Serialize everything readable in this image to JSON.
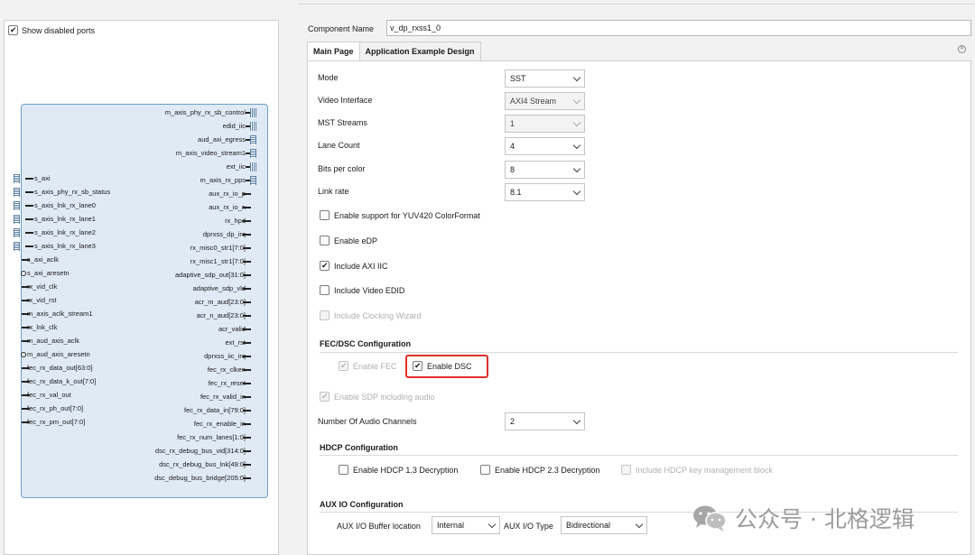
{
  "left": {
    "show_disabled_label": "Show disabled ports",
    "right_ports": [
      "m_axis_phy_rx_sb_control",
      "edid_iic",
      "aud_axi_egress",
      "m_axis_video_stream1",
      "ext_iic",
      "m_axis_rx_pps",
      "aux_rx_io_p",
      "aux_rx_io_n",
      "rx_hpd",
      "dprxss_dp_irq",
      "rx_misc0_str1[7:0]",
      "rx_misc1_str1[7:0]",
      "adaptive_sdp_out[31:0]",
      "adaptive_sdp_vld",
      "acr_m_aud[23:0]",
      "acr_n_aud[23:0]",
      "acr_valid",
      "ext_rst",
      "dprxss_iic_irq",
      "fec_rx_clken",
      "fec_rx_reset",
      "fec_rx_valid_in",
      "fec_rx_data_in[79:0]",
      "fec_rx_enable_in",
      "fec_rx_num_lanes[1:0]",
      "dsc_rx_debug_bus_vid[314:0]",
      "dsc_rx_debug_bus_lnk[49:0]",
      "dsc_debug_bus_bridge[205:0]"
    ],
    "left_bus_ports": [
      "s_axi",
      "s_axis_phy_rx_sb_status",
      "s_axis_lnk_rx_lane0",
      "s_axis_lnk_rx_lane1",
      "s_axis_lnk_rx_lane2",
      "s_axis_lnk_rx_lane3"
    ],
    "left_ports": [
      "s_axi_aclk",
      "s_axi_aresetn",
      "rx_vid_clk",
      "rx_vid_rst",
      "m_axis_aclk_stream1",
      "rx_lnk_clk",
      "m_aud_axis_aclk",
      "m_aud_axis_aresetn",
      "fec_rx_data_out[63:0]",
      "fec_rx_data_k_out[7:0]",
      "fec_rx_val_out",
      "fec_rx_ph_out[7:0]",
      "fec_rx_pm_out[7:0]"
    ]
  },
  "right": {
    "component_name_label": "Component Name",
    "component_name_value": "v_dp_rxss1_0",
    "tabs": [
      "Main Page",
      "Application Example Design"
    ],
    "fields": [
      {
        "label": "Mode",
        "value": "SST",
        "disabled": false
      },
      {
        "label": "Video Interface",
        "value": "AXI4 Stream",
        "disabled": true
      },
      {
        "label": "MST Streams",
        "value": "1",
        "disabled": true
      },
      {
        "label": "Lane Count",
        "value": "4",
        "disabled": false
      },
      {
        "label": "Bits per color",
        "value": "8",
        "disabled": false
      },
      {
        "label": "Link rate",
        "value": "8.1",
        "disabled": false
      }
    ],
    "checks": {
      "yuv420": "Enable support for YUV420 ColorFormat",
      "edp": "Enable eDP",
      "axi_iic": "Include AXI IIC",
      "video_edid": "Include Video EDID",
      "clocking_wizard": "Include Clocking Wizard",
      "enable_fec": "Enable FEC",
      "enable_dsc": "Enable DSC",
      "sdp_audio": "Enable SDP including audio",
      "hdcp13": "Enable HDCP 1.3 Decryption",
      "hdcp23": "Enable HDCP 2.3 Decryption",
      "hdcp_key": "Include HDCP key management block"
    },
    "fec_dsc_title": "FEC/DSC Configuration",
    "audio_channels_label": "Number Of Audio Channels",
    "audio_channels_value": "2",
    "hdcp_title": "HDCP Configuration",
    "aux_title": "AUX IO Configuration",
    "aux_buffer_label": "AUX I/O Buffer location",
    "aux_buffer_value": "Internal",
    "aux_type_label": "AUX I/O Type",
    "aux_type_value": "Bidirectional"
  },
  "watermark": "公众号 · 北格逻辑",
  "colors": {
    "highlight": "#e0302b",
    "block_fill": "#dfeaf5",
    "block_border": "#6f9ec9"
  }
}
